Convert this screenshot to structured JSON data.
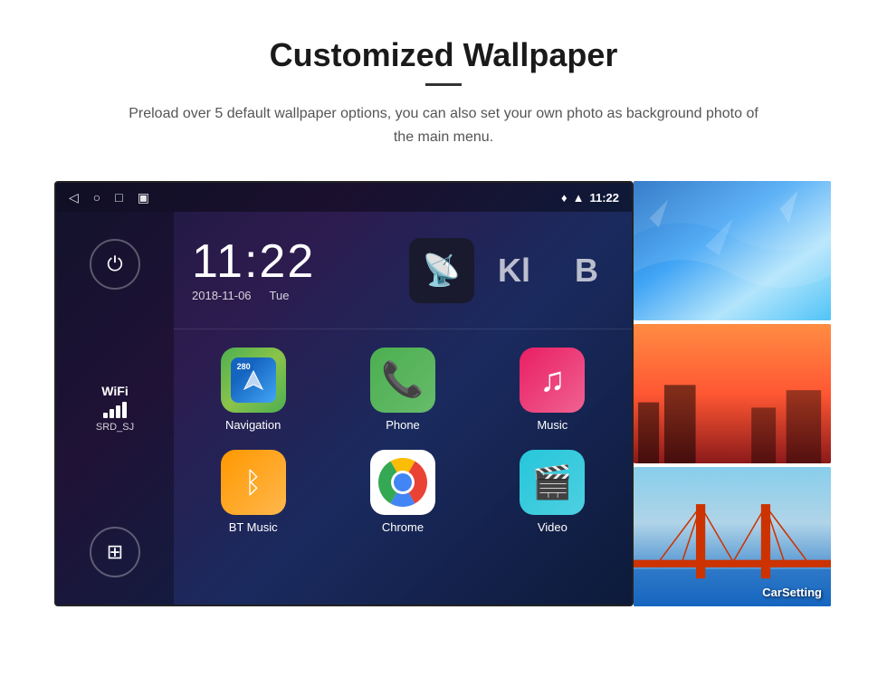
{
  "header": {
    "title": "Customized Wallpaper",
    "subtitle": "Preload over 5 default wallpaper options, you can also set your own photo as background photo of the main menu."
  },
  "statusBar": {
    "navIcons": [
      "◁",
      "○",
      "□",
      "🖼"
    ],
    "time": "11:22",
    "locationIcon": "♦",
    "signalIcon": "▲"
  },
  "clockWidget": {
    "time": "11:22",
    "date": "2018-11-06",
    "day": "Tue"
  },
  "sidebar": {
    "powerLabel": "⏻",
    "wifi": {
      "label": "WiFi",
      "ssid": "SRD_SJ"
    },
    "appsIcon": "⊞"
  },
  "apps": [
    {
      "name": "Navigation",
      "label": "Navigation",
      "badge": "280"
    },
    {
      "name": "Phone",
      "label": "Phone"
    },
    {
      "name": "Music",
      "label": "Music"
    },
    {
      "name": "BT Music",
      "label": "BT Music"
    },
    {
      "name": "Chrome",
      "label": "Chrome"
    },
    {
      "name": "Video",
      "label": "Video"
    }
  ],
  "wallpapers": [
    {
      "name": "blue-ice",
      "label": ""
    },
    {
      "name": "sunset-city",
      "label": ""
    },
    {
      "name": "golden-gate",
      "label": "CarSetting"
    }
  ]
}
